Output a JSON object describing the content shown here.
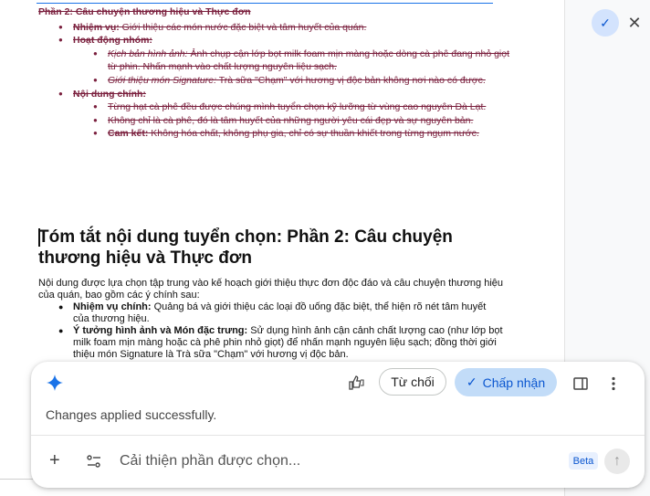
{
  "old_section": {
    "title": "Phần 2: Câu chuyện thương hiệu và Thực đơn",
    "items": [
      {
        "label": "Nhiệm vụ:",
        "text": " Giới thiệu các món nước đặc biệt và tâm huyết của quán."
      },
      {
        "label": "Hoạt động nhóm:",
        "text": "",
        "sub": [
          {
            "label": "Kịch bản hình ảnh:",
            "text": " Ảnh chụp cận lớp bọt milk foam mịn màng hoặc dòng cà phê đang nhỏ giọt từ phin. Nhấn mạnh vào chất lượng nguyên liệu sạch."
          },
          {
            "label": "Giới thiệu món Signature:",
            "text": " Trà sữa \"Chạm\" với hương vị độc bản không nơi nào có được."
          }
        ]
      },
      {
        "label": "Nội dung chính:",
        "text": "",
        "sub": [
          {
            "label": "",
            "text": "Từng hạt cà phê đều được chúng mình tuyển chọn kỹ lưỡng từ vùng cao nguyên Đà Lạt."
          },
          {
            "label": "",
            "text": "Không chỉ là cà phê, đó là tâm huyết của những người yêu cái đẹp và sự nguyên bản."
          },
          {
            "label": "Cam kết:",
            "text": " Không hóa chất, không phụ gia, chỉ có sự thuần khiết trong từng ngụm nước."
          }
        ]
      }
    ]
  },
  "new_section": {
    "heading": "Tóm tắt nội dung tuyển chọn: Phần 2: Câu chuyện thương hiệu và Thực đơn",
    "intro": "Nội dung được lựa chọn tập trung vào kế hoạch giới thiệu thực đơn độc đáo và câu chuyện thương hiệu của quán, bao gồm các ý chính sau:",
    "bullets": [
      {
        "label": "Nhiệm vụ chính:",
        "text": " Quảng bá và giới thiệu các loại đồ uống đặc biệt, thể hiện rõ nét tâm huyết của thương hiệu."
      },
      {
        "label": "Ý tưởng hình ảnh và Món đặc trưng:",
        "text": " Sử dụng hình ảnh cận cảnh chất lượng cao (như lớp bọt milk foam mịn màng hoặc cà phê phin nhỏ giọt) để nhấn mạnh nguyên liệu sạch; đồng thời giới thiệu món Signature là Trà sữa \"Chạm\" với hương vị độc bản."
      }
    ]
  },
  "side_panel": {
    "check_icon": "check-icon",
    "close_icon": "close-icon"
  },
  "assistant": {
    "reject_label": "Từ chối",
    "accept_label": "Chấp nhận",
    "status": "Changes applied successfully.",
    "prompt_placeholder": "Cải thiện phần được chọn...",
    "beta_badge": "Beta",
    "accent_color": "#0b57d0"
  }
}
